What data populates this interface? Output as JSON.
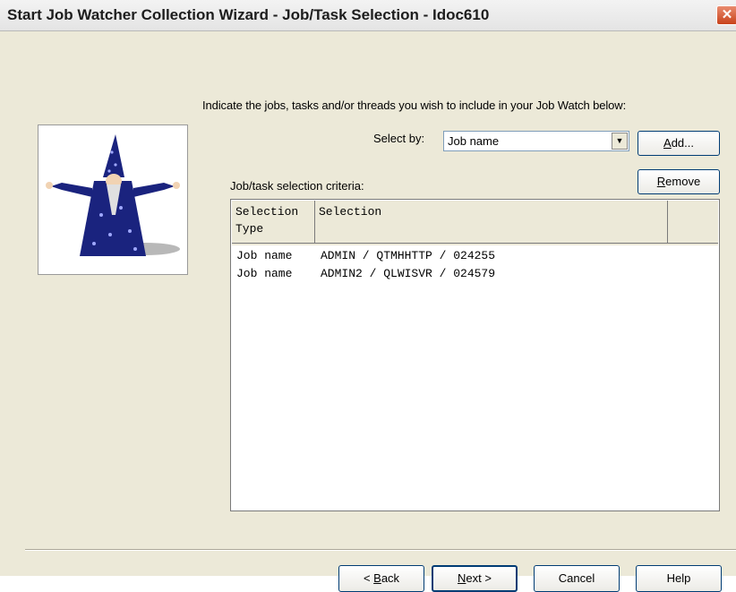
{
  "window": {
    "title": "Start Job Watcher Collection Wizard - Job/Task Selection - Idoc610",
    "close_symbol": "✕"
  },
  "instruction": "Indicate the jobs, tasks and/or threads you wish to include in your Job Watch below:",
  "select_by": {
    "label": "Select by:",
    "value": "Job name"
  },
  "buttons": {
    "add_mnemonic": "A",
    "add_rest": "dd...",
    "remove_mnemonic": "R",
    "remove_rest": "emove",
    "back_prefix": "< ",
    "back_mnemonic": "B",
    "back_rest": "ack",
    "next_mnemonic": "N",
    "next_rest": "ext >",
    "cancel": "Cancel",
    "help": "Help"
  },
  "criteria": {
    "label": "Job/task selection criteria:",
    "columns": [
      {
        "line1": "Selection",
        "line2": "Type"
      },
      {
        "line1": "Selection",
        "line2": ""
      }
    ],
    "rows": [
      {
        "type": "Job name",
        "selection": "ADMIN / QTMHHTTP / 024255"
      },
      {
        "type": "Job name",
        "selection": "ADMIN2 / QLWISVR / 024579"
      }
    ]
  },
  "icons": {
    "wizard": "wizard-illustration",
    "close": "close-icon",
    "dropdown": "chevron-down-icon"
  },
  "colors": {
    "window_bg": "#ece9d8",
    "close_button": "#c8421b",
    "button_border": "#003c74",
    "wizard_robe": "#1a237e"
  }
}
